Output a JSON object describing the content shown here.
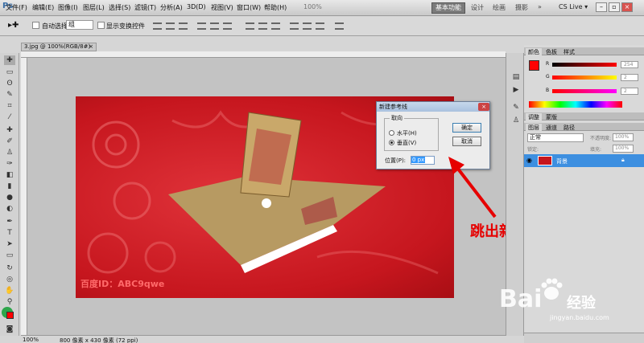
{
  "app": {
    "logo": "Ps"
  },
  "menubar": [
    "文件(F)",
    "编辑(E)",
    "图像(I)",
    "图层(L)",
    "选择(S)",
    "滤镜(T)",
    "分析(A)",
    "3D(D)",
    "视图(V)",
    "窗口(W)",
    "帮助(H)"
  ],
  "zoom_display": "100%",
  "workspaces": {
    "active": "基本功能",
    "others": [
      "设计",
      "绘画",
      "摄影"
    ],
    "more": "»"
  },
  "cslive": "CS Live ▾",
  "options": {
    "auto_select_label": "自动选择:",
    "auto_select_value": "组",
    "show_transform_label": "显示变换控件"
  },
  "document": {
    "tab_title": "3.jpg @ 100%(RGB/8#)",
    "status_zoom": "100%",
    "status_info": "800 像素 x 430 像素 (72 ppi)"
  },
  "watermark": "百度ID：ABC9qwe",
  "dialog": {
    "title": "新建参考线",
    "orientation_label": "取向",
    "horizontal_label": "水平(H)",
    "vertical_label": "垂直(V)",
    "selected": "vertical",
    "position_label": "位置(P):",
    "position_value": "0 px",
    "ok_label": "确定",
    "cancel_label": "取消"
  },
  "annotation": "跳出新建参考线框",
  "panels": {
    "color_tabs": [
      "颜色",
      "色板",
      "样式"
    ],
    "rgb": [
      {
        "label": "R",
        "value": "254",
        "color": "#ff0000"
      },
      {
        "label": "G",
        "value": "2",
        "color": "#00ff00"
      },
      {
        "label": "B",
        "value": "2",
        "color": "#0000ff"
      }
    ],
    "adjust_tabs": [
      "调整",
      "蒙版"
    ],
    "layer_tabs": [
      "图层",
      "通道",
      "路径"
    ],
    "blend_mode": "正常",
    "opacity_label": "不透明度:",
    "opacity_value": "100%",
    "lock_label": "锁定:",
    "fill_label": "填充:",
    "fill_value": "100%",
    "layer_name": "背景"
  },
  "baidu": {
    "brand": "Bai",
    "brand2": "du",
    "product": "经验",
    "url": "jingyan.baidu.com"
  },
  "colors": {
    "accent_red": "#e60000",
    "layer_select": "#3d8fe0",
    "fg_color": "#fe0202"
  }
}
